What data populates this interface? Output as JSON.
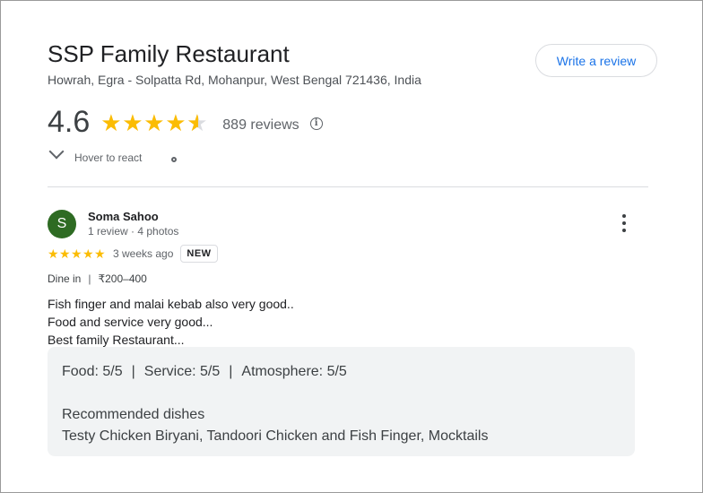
{
  "restaurant": {
    "name": "SSP Family Restaurant",
    "address": "Howrah, Egra - Solpatta Rd, Mohanpur, West Bengal 721436, India",
    "rating": "4.6",
    "rating_value": 4.6,
    "review_count": "889 reviews"
  },
  "actions": {
    "write_review": "Write a review",
    "hover_to_react": "Hover to react"
  },
  "review": {
    "avatar_letter": "S",
    "avatar_color": "#2e6b23",
    "name": "Soma Sahoo",
    "meta": "1 review · 4 photos",
    "stars": 5,
    "time_ago": "3 weeks ago",
    "badge": "NEW",
    "dine_type": "Dine in",
    "price": "₹200–400",
    "text_lines": [
      "Fish finger and malai kebab also very good..",
      "Food and service very good...",
      "Best family Restaurant..."
    ],
    "attributes": {
      "food": "Food: 5/5",
      "service": "Service: 5/5",
      "atmosphere": "Atmosphere: 5/5",
      "separator": "|"
    },
    "recommended_label": "Recommended dishes",
    "recommended_dishes": "Testy Chicken Biryani, Tandoori Chicken and Fish Finger, Mocktails"
  },
  "colors": {
    "accent": "#1a73e8",
    "star": "#fbbc04",
    "details_bg": "#f1f3f4"
  },
  "icons": [
    "star-icon",
    "info-icon",
    "chevron-down-icon",
    "share-icon",
    "more-vert-icon"
  ]
}
